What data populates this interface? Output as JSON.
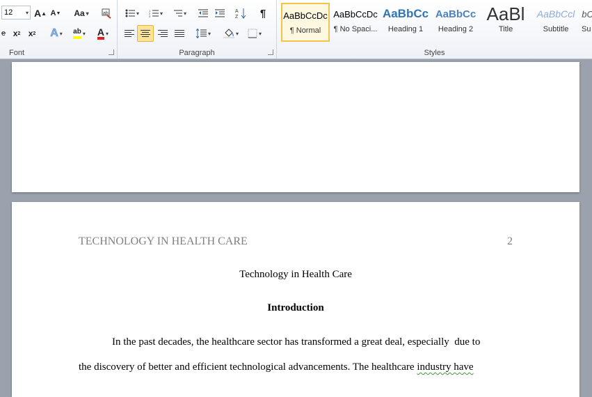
{
  "ribbon": {
    "font": {
      "group_label": "Font",
      "size_value": "12",
      "case_label": "Aa"
    },
    "paragraph": {
      "group_label": "Paragraph",
      "pilcrow": "¶"
    },
    "styles": {
      "group_label": "Styles",
      "tiles": [
        {
          "preview": "AaBbCcDc",
          "name": "¶ Normal",
          "color": "#000000"
        },
        {
          "preview": "AaBbCcDc",
          "name": "¶ No Spaci...",
          "color": "#000000"
        },
        {
          "preview": "AaBbCc",
          "name": "Heading 1",
          "color": "#2e75b6"
        },
        {
          "preview": "AaBbCc",
          "name": "Heading 2",
          "color": "#4f81bd"
        },
        {
          "preview": "AaBl",
          "name": "Title",
          "color": "#333333"
        },
        {
          "preview": "AaBbCcl",
          "name": "Subtitle",
          "color": "#8eaadb"
        },
        {
          "preview": "AaBbCcDc",
          "name": "Su",
          "color": "#333333"
        }
      ]
    }
  },
  "document": {
    "header_title": "TECHNOLOGY IN HEALTH CARE",
    "page_number": "2",
    "title": "Technology in Health Care",
    "heading": "Introduction",
    "paragraph_line1": "In the past decades, the healthcare sector has transformed a great deal, especially  due to",
    "paragraph_line2_a": "the discovery of better and efficient technological advancements. The healthcare ",
    "paragraph_line2_b": "industry have"
  }
}
